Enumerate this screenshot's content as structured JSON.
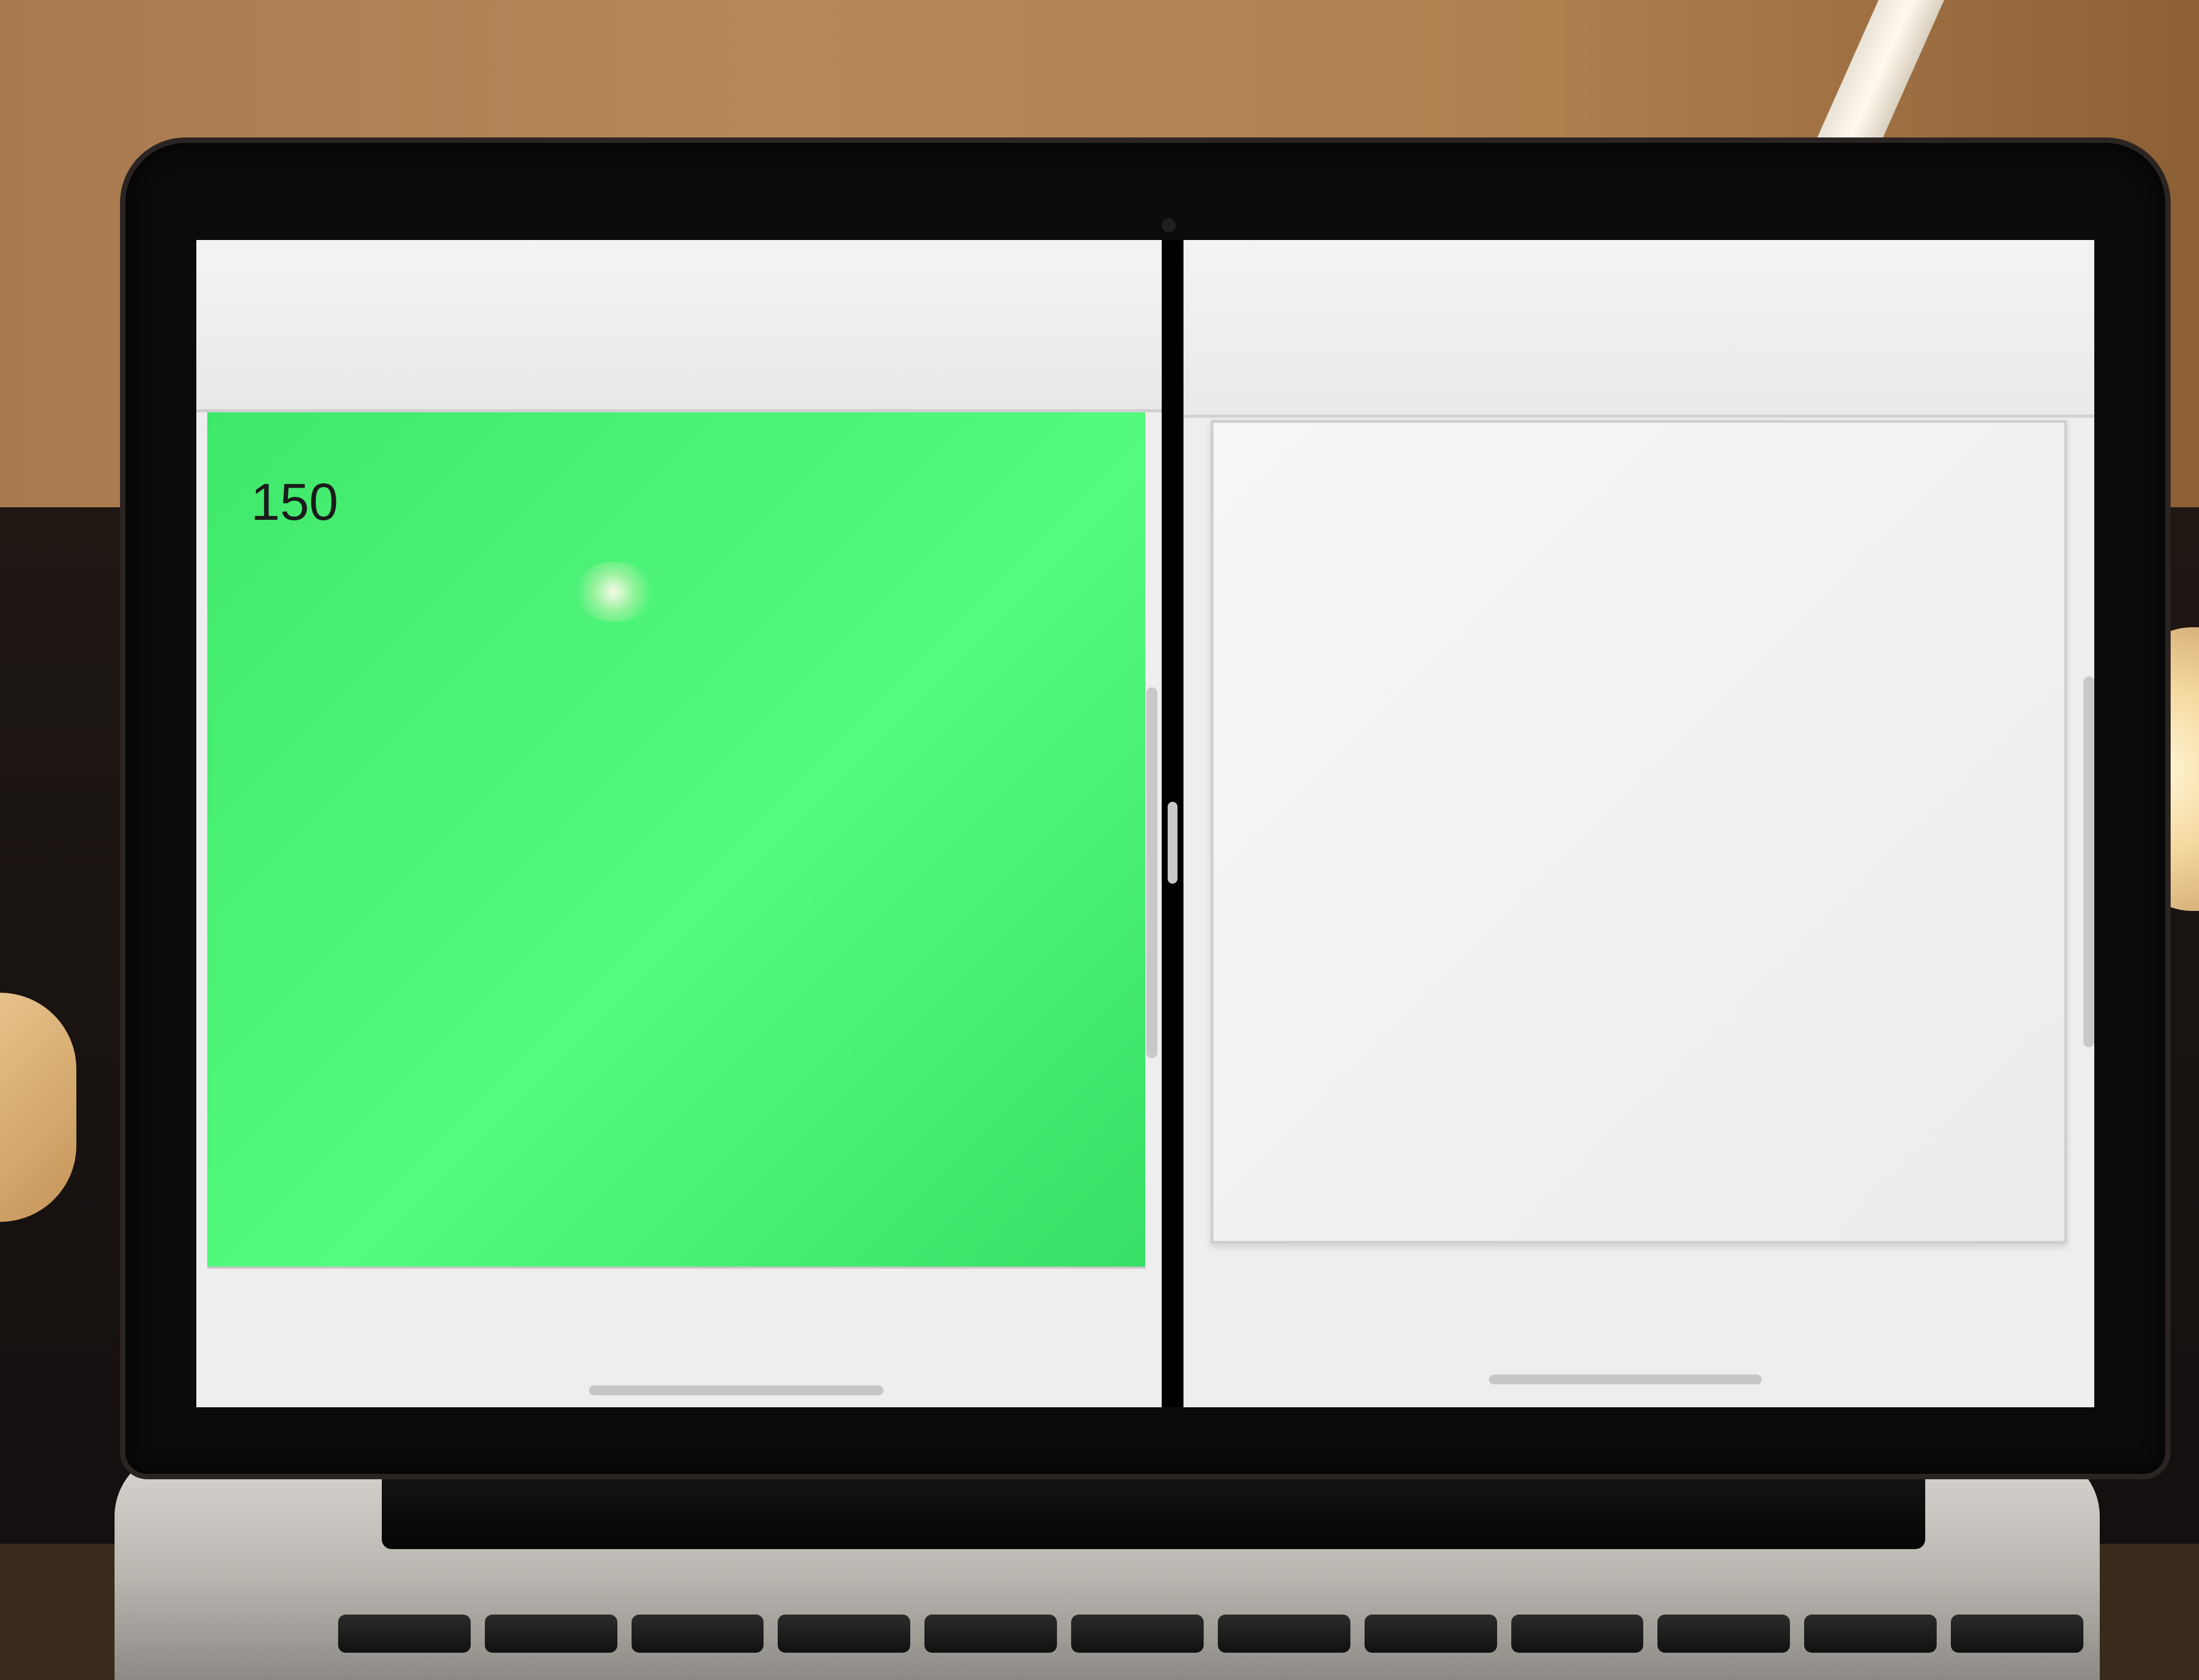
{
  "left_pane": {
    "panel_value": "150",
    "panel_color": "#4cf277"
  },
  "right_pane": {
    "panel_color": "#f1f1f1"
  }
}
